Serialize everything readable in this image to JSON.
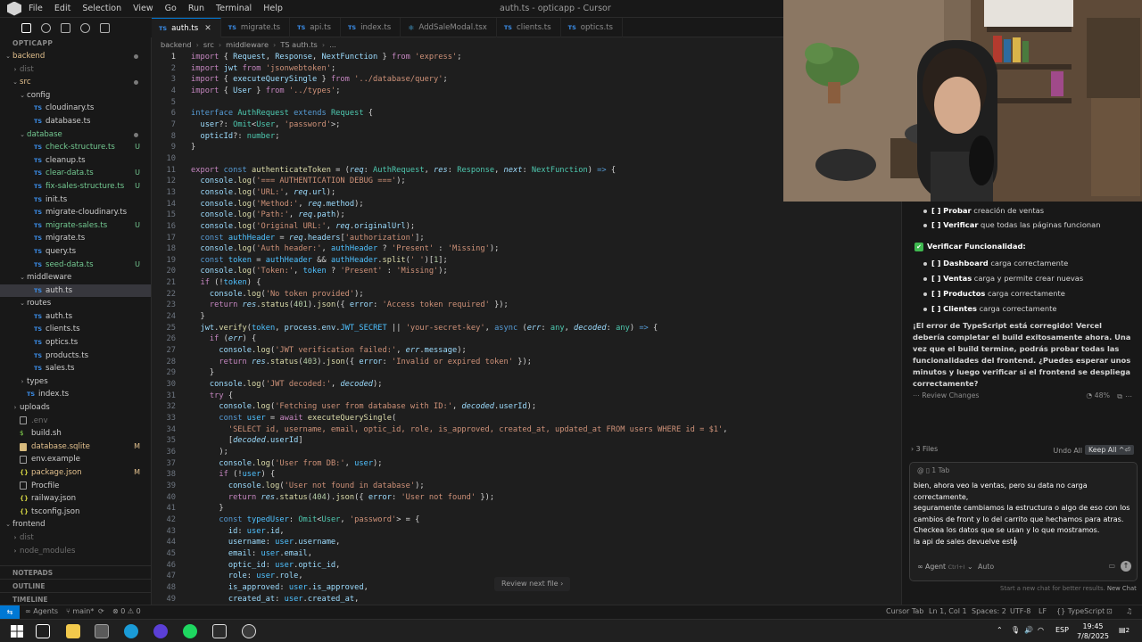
{
  "window": {
    "title": "auth.ts - opticapp - Cursor",
    "menu": [
      "File",
      "Edit",
      "Selection",
      "View",
      "Go",
      "Run",
      "Terminal",
      "Help"
    ]
  },
  "explorer": {
    "section": "OPTICAPP",
    "items": [
      {
        "name": "backend",
        "kind": "folder-open",
        "depth": 0,
        "tone": "mod",
        "dot": true
      },
      {
        "name": "dist",
        "kind": "folder",
        "depth": 1,
        "tone": "dim"
      },
      {
        "name": "src",
        "kind": "folder-open",
        "depth": 1,
        "tone": "mod",
        "dot": true
      },
      {
        "name": "config",
        "kind": "folder-open",
        "depth": 2
      },
      {
        "name": "cloudinary.ts",
        "kind": "ts",
        "depth": 3
      },
      {
        "name": "database.ts",
        "kind": "ts",
        "depth": 3
      },
      {
        "name": "database",
        "kind": "folder-open",
        "depth": 2,
        "tone": "untracked",
        "dot": true
      },
      {
        "name": "check-structure.ts",
        "kind": "ts",
        "depth": 3,
        "tone": "untracked",
        "status": "U"
      },
      {
        "name": "cleanup.ts",
        "kind": "ts",
        "depth": 3
      },
      {
        "name": "clear-data.ts",
        "kind": "ts",
        "depth": 3,
        "tone": "untracked",
        "status": "U"
      },
      {
        "name": "fix-sales-structure.ts",
        "kind": "ts",
        "depth": 3,
        "tone": "untracked",
        "status": "U"
      },
      {
        "name": "init.ts",
        "kind": "ts",
        "depth": 3
      },
      {
        "name": "migrate-cloudinary.ts",
        "kind": "ts",
        "depth": 3
      },
      {
        "name": "migrate-sales.ts",
        "kind": "ts",
        "depth": 3,
        "tone": "untracked",
        "status": "U"
      },
      {
        "name": "migrate.ts",
        "kind": "ts",
        "depth": 3
      },
      {
        "name": "query.ts",
        "kind": "ts",
        "depth": 3
      },
      {
        "name": "seed-data.ts",
        "kind": "ts",
        "depth": 3,
        "tone": "untracked",
        "status": "U"
      },
      {
        "name": "middleware",
        "kind": "folder-open",
        "depth": 2
      },
      {
        "name": "auth.ts",
        "kind": "ts",
        "depth": 3,
        "selected": true
      },
      {
        "name": "routes",
        "kind": "folder-open",
        "depth": 2
      },
      {
        "name": "auth.ts",
        "kind": "ts",
        "depth": 3
      },
      {
        "name": "clients.ts",
        "kind": "ts",
        "depth": 3
      },
      {
        "name": "optics.ts",
        "kind": "ts",
        "depth": 3
      },
      {
        "name": "products.ts",
        "kind": "ts",
        "depth": 3
      },
      {
        "name": "sales.ts",
        "kind": "ts",
        "depth": 3
      },
      {
        "name": "types",
        "kind": "folder",
        "depth": 2
      },
      {
        "name": "index.ts",
        "kind": "ts",
        "depth": 2
      },
      {
        "name": "uploads",
        "kind": "folder",
        "depth": 1
      },
      {
        "name": ".env",
        "kind": "gen",
        "depth": 1,
        "tone": "dim"
      },
      {
        "name": "build.sh",
        "kind": "sh",
        "depth": 1
      },
      {
        "name": "database.sqlite",
        "kind": "db",
        "depth": 1,
        "tone": "mod",
        "status": "M"
      },
      {
        "name": "env.example",
        "kind": "gen",
        "depth": 1
      },
      {
        "name": "package.json",
        "kind": "json",
        "depth": 1,
        "tone": "mod",
        "status": "M"
      },
      {
        "name": "Procfile",
        "kind": "gen",
        "depth": 1
      },
      {
        "name": "railway.json",
        "kind": "json",
        "depth": 1
      },
      {
        "name": "tsconfig.json",
        "kind": "json",
        "depth": 1
      },
      {
        "name": "frontend",
        "kind": "folder-open",
        "depth": 0
      },
      {
        "name": "dist",
        "kind": "folder",
        "depth": 1,
        "tone": "dim"
      },
      {
        "name": "node_modules",
        "kind": "folder",
        "depth": 1,
        "tone": "dim"
      }
    ],
    "bottom_sections": [
      "NOTEPADS",
      "OUTLINE",
      "TIMELINE"
    ]
  },
  "tabs": [
    {
      "label": "auth.ts",
      "icon": "TS",
      "active": true
    },
    {
      "label": "migrate.ts",
      "icon": "TS"
    },
    {
      "label": "api.ts",
      "icon": "TS"
    },
    {
      "label": "index.ts",
      "icon": "TS"
    },
    {
      "label": "AddSaleModal.tsx",
      "icon": "JSX"
    },
    {
      "label": "clients.ts",
      "icon": "TS"
    },
    {
      "label": "optics.ts",
      "icon": "TS"
    }
  ],
  "breadcrumb": [
    "backend",
    "src",
    "middleware",
    "TS auth.ts",
    "..."
  ],
  "editor": {
    "review_next": "Review next file"
  },
  "chat": {
    "checklist_top": [
      {
        "box": "[ ]",
        "bold": "Probar",
        "rest": " creación de ventas"
      },
      {
        "box": "[ ]",
        "bold": "Verificar",
        "rest": " que todas las páginas funcionan"
      }
    ],
    "section_heading": "Verificar Funcionalidad:",
    "checklist": [
      {
        "box": "[ ]",
        "bold": "Dashboard",
        "rest": " carga correctamente"
      },
      {
        "box": "[ ]",
        "bold": "Ventas",
        "rest": " carga y permite crear nuevas"
      },
      {
        "box": "[ ]",
        "bold": "Productos",
        "rest": " carga correctamente"
      },
      {
        "box": "[ ]",
        "bold": "Clientes",
        "rest": " carga correctamente"
      }
    ],
    "message": "¡El error de TypeScript está corregido! Vercel debería completar el build exitosamente ahora. Una vez que el build termine, podrás probar todas las funcionalidades del frontend. ¿Puedes esperar unos minutos y luego verificar si el frontend se despliega correctamente?",
    "review_changes": "Review Changes",
    "progress": "48%",
    "files_count": "3 Files",
    "undo_all": "Undo All",
    "keep_all": "Keep All",
    "keep_all_shortcut": "^⏎",
    "context_chip": "1 Tab",
    "prompt_lines": [
      "bien, ahora veo la ventas, pero su data no carga correctamente,",
      "seguramente cambiamos la estructura o algo de eso con los",
      "cambios de front y lo del carrito que hechamos para atras.",
      "Checkea los datos que se usan y lo que mostramos.",
      "la api de sales devuelve esto"
    ],
    "agent_label": "Agent",
    "agent_shortcut": "Ctrl+I",
    "model_label": "Auto",
    "new_chat_hint": "Start a new chat for better results.",
    "new_chat_label": "New Chat"
  },
  "statusbar": {
    "agents": "Agents",
    "branch": "main*",
    "problems": "0",
    "warnings": "0",
    "cursor_tab": "Cursor Tab",
    "position": "Ln 1, Col 1",
    "spaces": "Spaces: 2",
    "encoding": "UTF-8",
    "eol": "LF",
    "language": "TypeScript"
  },
  "taskbar": {
    "lang": "ESP",
    "time": "19:45",
    "date": "7/8/2025",
    "notifications": "2"
  }
}
